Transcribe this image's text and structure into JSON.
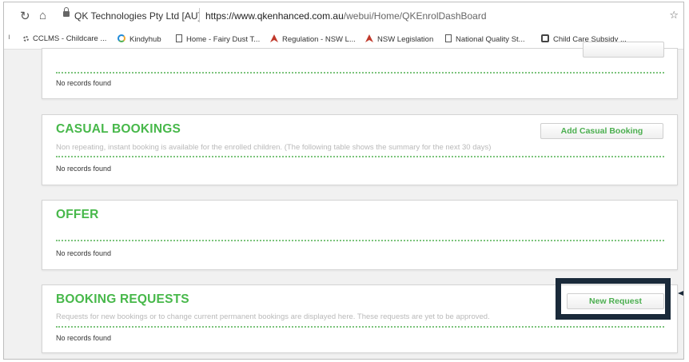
{
  "browser": {
    "site_label": "QK Technologies Pty Ltd [AU]",
    "url_domain": "https://www.qkenhanced.com.au",
    "url_path": "/webui/Home/QKEnrolDashBoard",
    "bookmarks": [
      {
        "label": "CCLMS - Childcare ...",
        "icon": "gear-icon"
      },
      {
        "label": "Kindyhub",
        "icon": "ring-icon"
      },
      {
        "label": "Home - Fairy Dust T...",
        "icon": "page-icon"
      },
      {
        "label": "Regulation - NSW L...",
        "icon": "crest-icon"
      },
      {
        "label": "NSW Legislation",
        "icon": "crest-icon"
      },
      {
        "label": "National Quality St...",
        "icon": "page-icon"
      },
      {
        "label": "Child Care Subsidy ...",
        "icon": "gov-icon"
      }
    ]
  },
  "panels": {
    "top": {
      "no_records": "No records found"
    },
    "casual": {
      "title": "CASUAL BOOKINGS",
      "description": "Non repeating, instant booking is available for the enrolled children. (The following table shows the summary for the next 30 days)",
      "button": "Add Casual Booking",
      "no_records": "No records found"
    },
    "offer": {
      "title": "OFFER",
      "no_records": "No records found"
    },
    "requests": {
      "title": "BOOKING REQUESTS",
      "description": "Requests for new bookings or to change current permanent bookings are displayed here. These requests are yet to be approved.",
      "button": "New Request",
      "no_records": "No records found"
    }
  },
  "colors": {
    "accent": "#47b84a",
    "highlight": "#1a2a3a"
  }
}
